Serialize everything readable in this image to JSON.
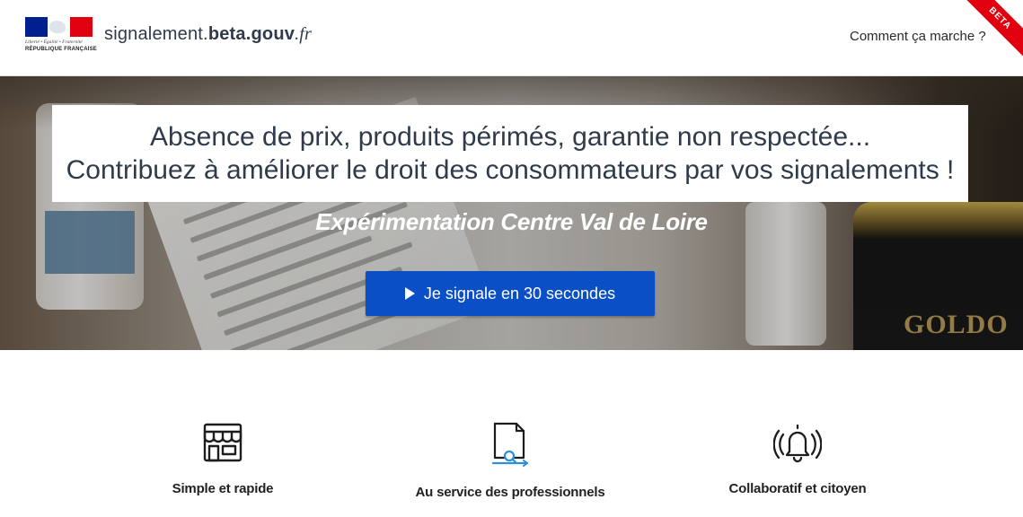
{
  "header": {
    "logo": {
      "motto": "Liberté • Égalité • Fraternité",
      "country": "RÉPUBLIQUE FRANÇAISE"
    },
    "site_name": {
      "part1": "signalement.",
      "part2": "beta.gouv",
      "part3": ".fr"
    },
    "nav_link": "Comment ça marche ?",
    "ribbon": "BETA"
  },
  "hero": {
    "title_line1": "Absence de prix, produits périmés, garantie non respectée...",
    "title_line2": "Contribuez à améliorer le droit des consommateurs par vos signalements !",
    "subtitle": "Expérimentation Centre Val de Loire",
    "cta_label": "Je signale en 30 secondes",
    "background_text": "GOLDO"
  },
  "features": [
    {
      "icon": "shop-icon",
      "label": "Simple et rapide"
    },
    {
      "icon": "document-search-icon",
      "label": "Au service des professionnels"
    },
    {
      "icon": "bell-ringing-icon",
      "label": "Collaboratif et citoyen"
    }
  ],
  "colors": {
    "primary": "#0a4fc5",
    "ribbon": "#e1000f",
    "flag_blue": "#00208f",
    "flag_red": "#e1000f",
    "accent_icon": "#2f8fd6"
  }
}
